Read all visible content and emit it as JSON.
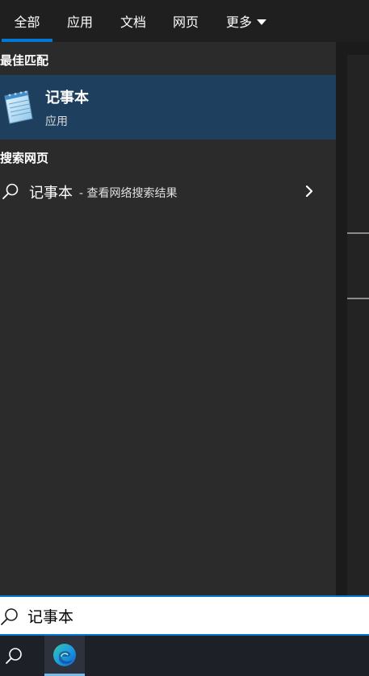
{
  "tabs": [
    {
      "label": "全部",
      "active": true
    },
    {
      "label": "应用",
      "active": false
    },
    {
      "label": "文档",
      "active": false
    },
    {
      "label": "网页",
      "active": false
    },
    {
      "label": "更多",
      "active": false
    }
  ],
  "best_match": {
    "title": "最佳匹配",
    "app_name": "记事本",
    "app_type": "应用",
    "icon": "notepad-icon"
  },
  "web_search": {
    "title": "搜索网页",
    "query": "记事本",
    "hint": " - 查看网络搜索结果",
    "icon": "search-icon"
  },
  "search_box": {
    "value": "记事本"
  },
  "taskbar": {
    "search_icon": "search-icon",
    "pinned_app_icon": "edge-icon"
  },
  "colors": {
    "accent": "#0078d4",
    "selected_row": "#1f3f5e",
    "panel": "#2b2b2b"
  }
}
